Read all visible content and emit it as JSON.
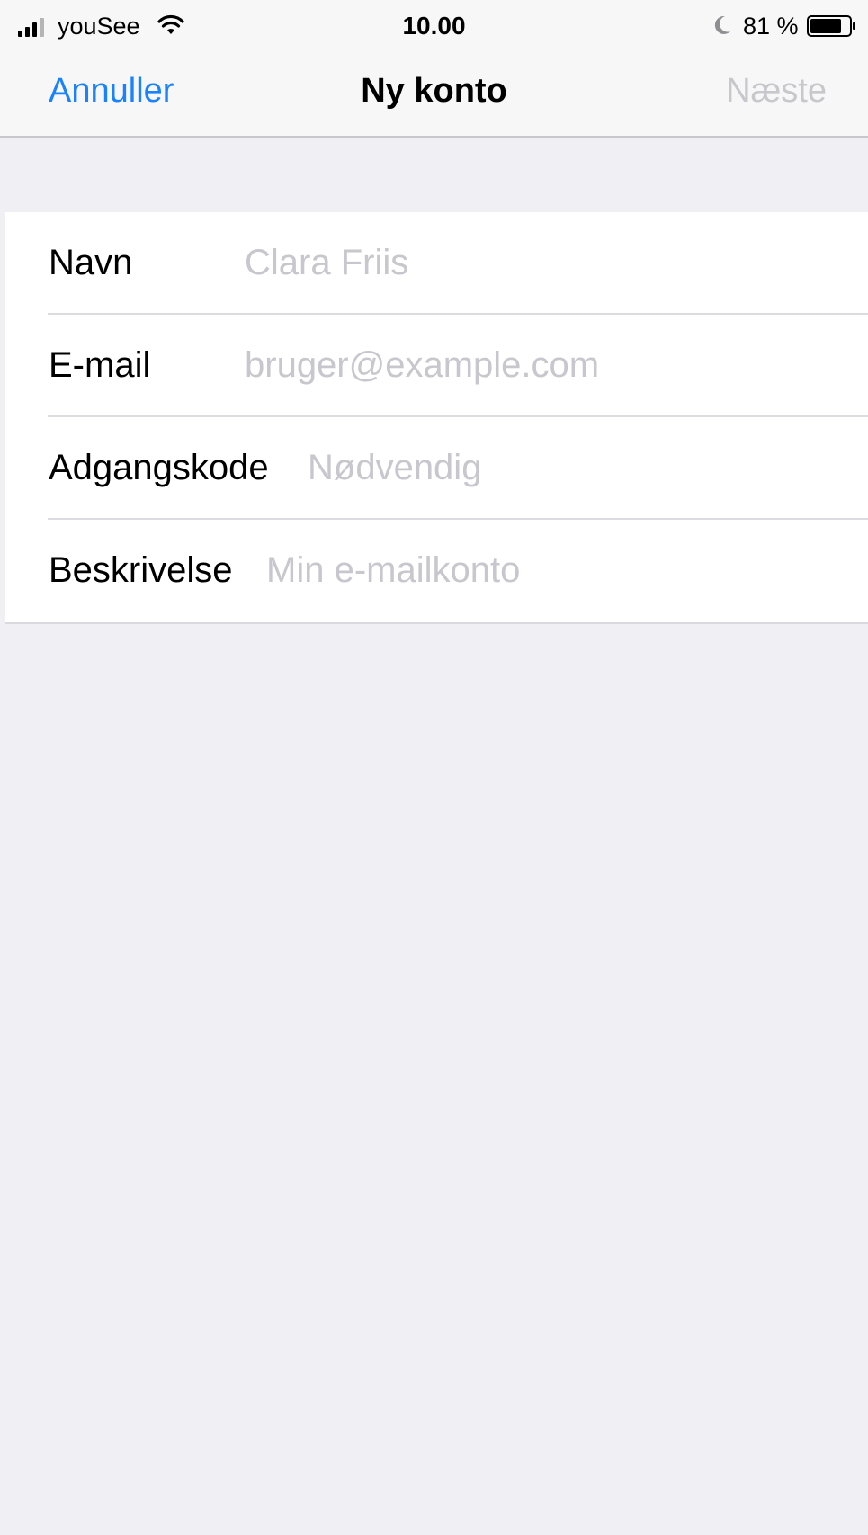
{
  "status_bar": {
    "carrier": "youSee",
    "time": "10.00",
    "battery_percent": "81 %",
    "battery_level": 0.81,
    "signal_icon": "signal-bars-icon",
    "wifi_icon": "wifi-icon",
    "dnd_icon": "moon-icon",
    "battery_icon": "battery-icon"
  },
  "nav": {
    "cancel_label": "Annuller",
    "title": "Ny konto",
    "next_label": "Næste"
  },
  "form": {
    "fields": [
      {
        "label": "Navn",
        "value": "",
        "placeholder": "Clara Friis"
      },
      {
        "label": "E-mail",
        "value": "",
        "placeholder": "bruger@example.com"
      },
      {
        "label": "Adgangskode",
        "value": "",
        "placeholder": "Nødvendig"
      },
      {
        "label": "Beskrivelse",
        "value": "",
        "placeholder": "Min e-mailkonto"
      }
    ]
  },
  "colors": {
    "accent": "#1a82fb",
    "disabled": "#c7c7cc",
    "background": "#efeff4",
    "placeholder": "#c7c7cd"
  }
}
